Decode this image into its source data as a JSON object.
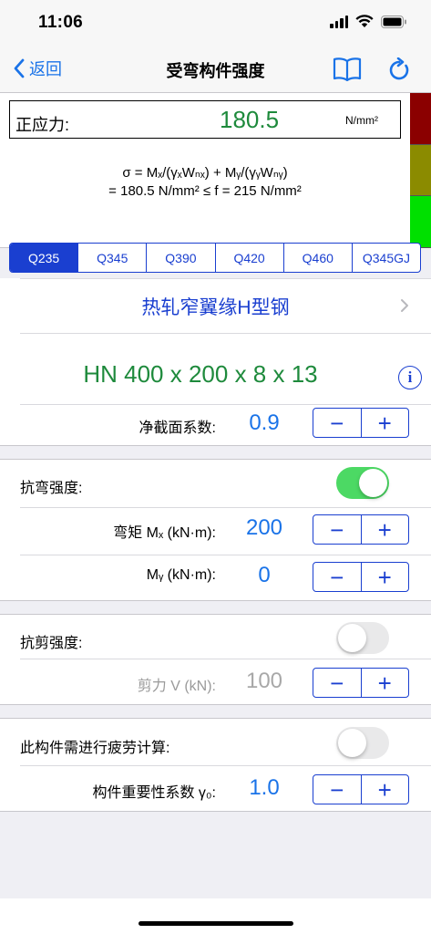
{
  "status_bar": {
    "time": "11:06"
  },
  "nav": {
    "back_label": "返回",
    "title": "受弯构件强度"
  },
  "result": {
    "stress_label": "正应力:",
    "stress_value": "180.5",
    "stress_unit": "N/mm²",
    "formula_line1": "σ = Mₓ/(γₓWₙₓ) + Mᵧ/(γᵧWₙᵧ)",
    "formula_line2": "= 180.5 N/mm² ≤ f = 215 N/mm²",
    "indicator_colors": [
      "#8b0000",
      "#8b8b00",
      "#00e000"
    ]
  },
  "steel_grades": {
    "items": [
      "Q235",
      "Q345",
      "Q390",
      "Q420",
      "Q460",
      "Q345GJ"
    ],
    "selected": "Q235"
  },
  "section": {
    "type_label": "热轧窄翼缘H型钢",
    "profile_label": "HN 400 x 200 x 8 x 13",
    "net_coef_label": "净截面系数:",
    "net_coef_value": "0.9"
  },
  "bending": {
    "title": "抗弯强度:",
    "enabled": true,
    "mx_label": "弯矩  Mₓ (kN·m):",
    "mx_value": "200",
    "my_label": "Mᵧ (kN·m):",
    "my_value": "0"
  },
  "shear": {
    "title": "抗剪强度:",
    "enabled": false,
    "v_label": "剪力  V (kN):",
    "v_value": "100"
  },
  "fatigue": {
    "title": "此构件需进行疲劳计算:",
    "enabled": false,
    "importance_label": "构件重要性系数  γ₀:",
    "importance_value": "1.0"
  },
  "stepper": {
    "minus": "−",
    "plus": "+"
  },
  "colors": {
    "accent": "#1a3fd0",
    "value_blue": "#1a73e8",
    "result_green": "#1e8a3c",
    "toggle_on": "#4cd964"
  }
}
